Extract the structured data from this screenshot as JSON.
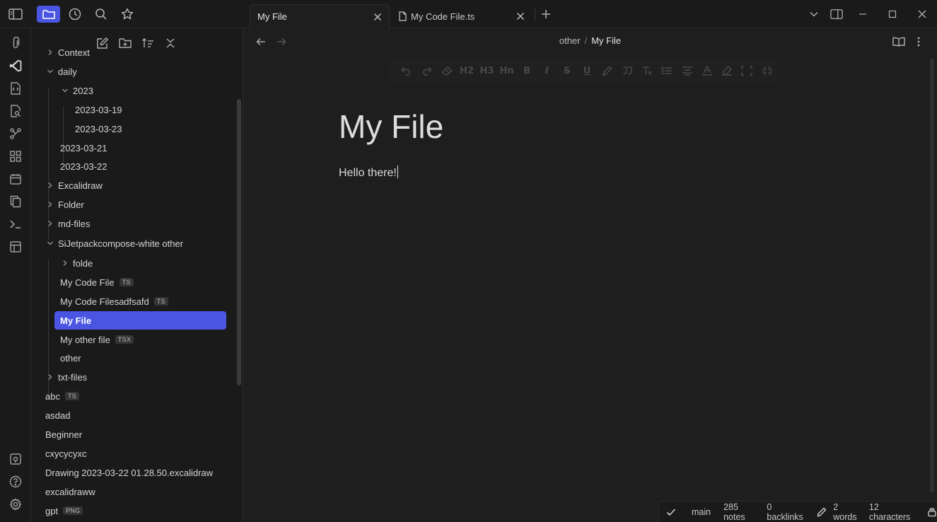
{
  "tabs": [
    {
      "label": "My File",
      "active": true
    },
    {
      "label": "My Code File.ts",
      "active": false
    }
  ],
  "breadcrumb": {
    "parent": "other",
    "separator": "/",
    "current": "My File"
  },
  "document": {
    "title": "My File",
    "body": "Hello there!"
  },
  "tree": [
    {
      "label": "Context",
      "type": "folder",
      "expanded": false
    },
    {
      "label": "daily",
      "type": "folder",
      "expanded": true
    },
    {
      "label": "2023",
      "type": "folder",
      "expanded": true
    },
    {
      "label": "2023-03-19",
      "type": "file"
    },
    {
      "label": "2023-03-23",
      "type": "file"
    },
    {
      "label": "2023-03-21",
      "type": "file"
    },
    {
      "label": "2023-03-22",
      "type": "file"
    },
    {
      "label": "Excalidraw",
      "type": "folder",
      "expanded": false
    },
    {
      "label": "Folder",
      "type": "folder",
      "expanded": false
    },
    {
      "label": "md-files",
      "type": "folder",
      "expanded": false
    },
    {
      "label": "SiJetpackcompose-white other",
      "type": "folder",
      "expanded": true
    },
    {
      "label": "folde",
      "type": "folder",
      "expanded": false
    },
    {
      "label": "My Code File",
      "type": "file",
      "badge": "TS"
    },
    {
      "label": "My Code Filesadfsafd",
      "type": "file",
      "badge": "TS"
    },
    {
      "label": "My File",
      "type": "file",
      "selected": true
    },
    {
      "label": "My other file",
      "type": "file",
      "badge": "TSX"
    },
    {
      "label": "other",
      "type": "file"
    },
    {
      "label": "txt-files",
      "type": "folder",
      "expanded": false
    },
    {
      "label": "abc",
      "type": "file",
      "badge": "TS"
    },
    {
      "label": "asdad",
      "type": "file"
    },
    {
      "label": "Beginner",
      "type": "file"
    },
    {
      "label": "cxycycyxc",
      "type": "file"
    },
    {
      "label": "Drawing 2023-03-22 01.28.50.excalidraw",
      "type": "file"
    },
    {
      "label": "excalidraww",
      "type": "file"
    },
    {
      "label": "gpt",
      "type": "file",
      "badge": "PNG"
    }
  ],
  "format_toolbar": {
    "h2": "H2",
    "h3": "H3",
    "hn": "Hn",
    "bold": "B",
    "italic": "I",
    "strike": "S",
    "underline": "U"
  },
  "status": {
    "branch": "main",
    "notes": "285 notes",
    "backlinks": "0 backlinks",
    "words": "2 words",
    "characters": "12 characters"
  },
  "colors": {
    "accent": "#4a56e2",
    "background": "#1e1e1e",
    "sidebar": "#1a1a1a"
  }
}
